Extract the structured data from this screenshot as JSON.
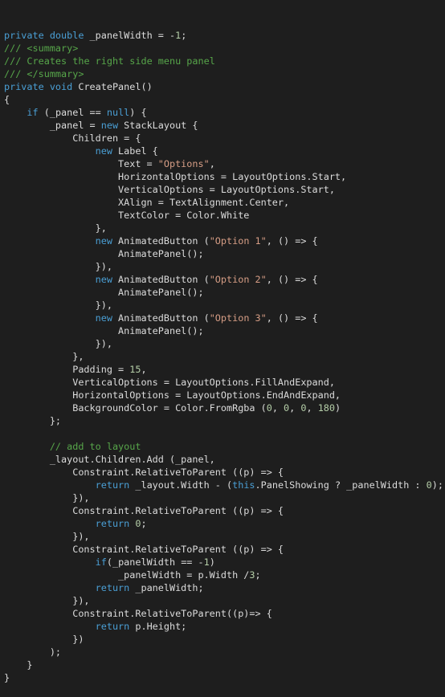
{
  "editor": {
    "background_color": "#1e1e1e",
    "default_text_color": "#dcdcdc",
    "keyword_color": "#4a9fd5",
    "comment_color": "#57a64a",
    "string_color": "#d69d85",
    "number_color": "#b5cea8",
    "language": "C#",
    "line_count": 51
  },
  "code": {
    "lines": [
      [
        {
          "t": "private ",
          "c": "keyword"
        },
        {
          "t": "double ",
          "c": "keyword"
        },
        {
          "t": "_panelWidth = -",
          "c": "default"
        },
        {
          "t": "1",
          "c": "number"
        },
        {
          "t": ";",
          "c": "default"
        }
      ],
      [
        {
          "t": "/// ",
          "c": "comment"
        },
        {
          "t": "<summary>",
          "c": "comment"
        }
      ],
      [
        {
          "t": "/// ",
          "c": "comment"
        },
        {
          "t": "Creates the right side menu panel",
          "c": "comment"
        }
      ],
      [
        {
          "t": "/// ",
          "c": "comment"
        },
        {
          "t": "</summary>",
          "c": "comment"
        }
      ],
      [
        {
          "t": "private ",
          "c": "keyword"
        },
        {
          "t": "void ",
          "c": "keyword"
        },
        {
          "t": "CreatePanel()",
          "c": "default"
        }
      ],
      [
        {
          "t": "{",
          "c": "default"
        }
      ],
      [
        {
          "t": "    ",
          "c": "default"
        },
        {
          "t": "if",
          "c": "keyword"
        },
        {
          "t": " (_panel == ",
          "c": "default"
        },
        {
          "t": "null",
          "c": "keyword"
        },
        {
          "t": ") {",
          "c": "default"
        }
      ],
      [
        {
          "t": "        _panel = ",
          "c": "default"
        },
        {
          "t": "new",
          "c": "keyword"
        },
        {
          "t": " StackLayout {",
          "c": "default"
        }
      ],
      [
        {
          "t": "            Children = {",
          "c": "default"
        }
      ],
      [
        {
          "t": "                ",
          "c": "default"
        },
        {
          "t": "new",
          "c": "keyword"
        },
        {
          "t": " Label {",
          "c": "default"
        }
      ],
      [
        {
          "t": "                    Text = ",
          "c": "default"
        },
        {
          "t": "\"Options\"",
          "c": "string"
        },
        {
          "t": ",",
          "c": "default"
        }
      ],
      [
        {
          "t": "                    HorizontalOptions = LayoutOptions.Start,",
          "c": "default"
        }
      ],
      [
        {
          "t": "                    VerticalOptions = LayoutOptions.Start,",
          "c": "default"
        }
      ],
      [
        {
          "t": "                    XAlign = TextAlignment.Center,",
          "c": "default"
        }
      ],
      [
        {
          "t": "                    TextColor = Color.White",
          "c": "default"
        }
      ],
      [
        {
          "t": "                },",
          "c": "default"
        }
      ],
      [
        {
          "t": "                ",
          "c": "default"
        },
        {
          "t": "new",
          "c": "keyword"
        },
        {
          "t": " AnimatedButton (",
          "c": "default"
        },
        {
          "t": "\"Option 1\"",
          "c": "string"
        },
        {
          "t": ", () => {",
          "c": "default"
        }
      ],
      [
        {
          "t": "                    AnimatePanel();",
          "c": "default"
        }
      ],
      [
        {
          "t": "                }),",
          "c": "default"
        }
      ],
      [
        {
          "t": "                ",
          "c": "default"
        },
        {
          "t": "new",
          "c": "keyword"
        },
        {
          "t": " AnimatedButton (",
          "c": "default"
        },
        {
          "t": "\"Option 2\"",
          "c": "string"
        },
        {
          "t": ", () => {",
          "c": "default"
        }
      ],
      [
        {
          "t": "                    AnimatePanel();",
          "c": "default"
        }
      ],
      [
        {
          "t": "                }),",
          "c": "default"
        }
      ],
      [
        {
          "t": "                ",
          "c": "default"
        },
        {
          "t": "new",
          "c": "keyword"
        },
        {
          "t": " AnimatedButton (",
          "c": "default"
        },
        {
          "t": "\"Option 3\"",
          "c": "string"
        },
        {
          "t": ", () => {",
          "c": "default"
        }
      ],
      [
        {
          "t": "                    AnimatePanel();",
          "c": "default"
        }
      ],
      [
        {
          "t": "                }),",
          "c": "default"
        }
      ],
      [
        {
          "t": "            },",
          "c": "default"
        }
      ],
      [
        {
          "t": "            Padding = ",
          "c": "default"
        },
        {
          "t": "15",
          "c": "number"
        },
        {
          "t": ",",
          "c": "default"
        }
      ],
      [
        {
          "t": "            VerticalOptions = LayoutOptions.FillAndExpand,",
          "c": "default"
        }
      ],
      [
        {
          "t": "            HorizontalOptions = LayoutOptions.EndAndExpand,",
          "c": "default"
        }
      ],
      [
        {
          "t": "            BackgroundColor = Color.FromRgba (",
          "c": "default"
        },
        {
          "t": "0",
          "c": "number"
        },
        {
          "t": ", ",
          "c": "default"
        },
        {
          "t": "0",
          "c": "number"
        },
        {
          "t": ", ",
          "c": "default"
        },
        {
          "t": "0",
          "c": "number"
        },
        {
          "t": ", ",
          "c": "default"
        },
        {
          "t": "180",
          "c": "number"
        },
        {
          "t": ")",
          "c": "default"
        }
      ],
      [
        {
          "t": "        };",
          "c": "default"
        }
      ],
      [
        {
          "t": "",
          "c": "default"
        }
      ],
      [
        {
          "t": "        ",
          "c": "default"
        },
        {
          "t": "// add to layout",
          "c": "comment"
        }
      ],
      [
        {
          "t": "        _layout.Children.Add (_panel,",
          "c": "default"
        }
      ],
      [
        {
          "t": "            Constraint.RelativeToParent ((p) => {",
          "c": "default"
        }
      ],
      [
        {
          "t": "                ",
          "c": "default"
        },
        {
          "t": "return",
          "c": "keyword"
        },
        {
          "t": " _layout.Width - (",
          "c": "default"
        },
        {
          "t": "this",
          "c": "keyword"
        },
        {
          "t": ".PanelShowing ? _panelWidth : ",
          "c": "default"
        },
        {
          "t": "0",
          "c": "number"
        },
        {
          "t": ");",
          "c": "default"
        }
      ],
      [
        {
          "t": "            }),",
          "c": "default"
        }
      ],
      [
        {
          "t": "            Constraint.RelativeToParent ((p) => {",
          "c": "default"
        }
      ],
      [
        {
          "t": "                ",
          "c": "default"
        },
        {
          "t": "return",
          "c": "keyword"
        },
        {
          "t": " ",
          "c": "default"
        },
        {
          "t": "0",
          "c": "number"
        },
        {
          "t": ";",
          "c": "default"
        }
      ],
      [
        {
          "t": "            }),",
          "c": "default"
        }
      ],
      [
        {
          "t": "            Constraint.RelativeToParent ((p) => {",
          "c": "default"
        }
      ],
      [
        {
          "t": "                ",
          "c": "default"
        },
        {
          "t": "if",
          "c": "keyword"
        },
        {
          "t": "(_panelWidth == -",
          "c": "default"
        },
        {
          "t": "1",
          "c": "number"
        },
        {
          "t": ")",
          "c": "default"
        }
      ],
      [
        {
          "t": "                    _panelWidth = p.Width /",
          "c": "default"
        },
        {
          "t": "3",
          "c": "number"
        },
        {
          "t": ";",
          "c": "default"
        }
      ],
      [
        {
          "t": "                ",
          "c": "default"
        },
        {
          "t": "return",
          "c": "keyword"
        },
        {
          "t": " _panelWidth;",
          "c": "default"
        }
      ],
      [
        {
          "t": "            }),",
          "c": "default"
        }
      ],
      [
        {
          "t": "            Constraint.RelativeToParent((p)=> {",
          "c": "default"
        }
      ],
      [
        {
          "t": "                ",
          "c": "default"
        },
        {
          "t": "return",
          "c": "keyword"
        },
        {
          "t": " p.Height;",
          "c": "default"
        }
      ],
      [
        {
          "t": "            })",
          "c": "default"
        }
      ],
      [
        {
          "t": "        );",
          "c": "default"
        }
      ],
      [
        {
          "t": "    }",
          "c": "default"
        }
      ],
      [
        {
          "t": "}",
          "c": "default"
        }
      ]
    ]
  }
}
